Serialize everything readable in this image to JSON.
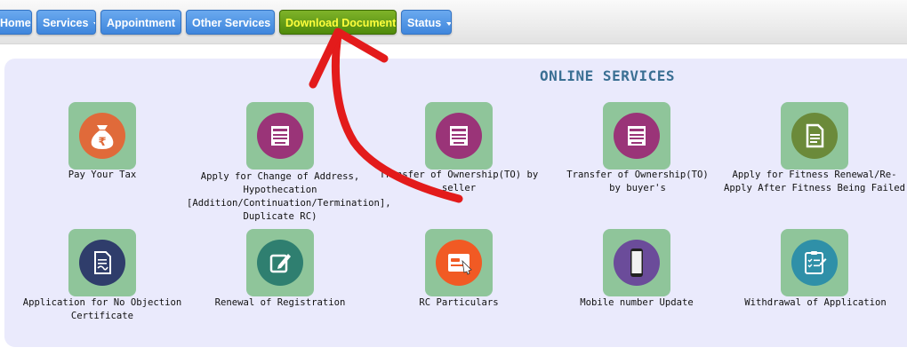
{
  "nav": {
    "home": "Home",
    "services": "Services",
    "appointment": "Appointment",
    "other_services": "Other Services",
    "download_document": "Download Document",
    "status": "Status"
  },
  "panel": {
    "title": "ONLINE SERVICES"
  },
  "services": [
    {
      "label": "Pay Your Tax",
      "icon": "money-bag-rupee-icon",
      "color": "#e06a3a"
    },
    {
      "label": "Apply for Change of Address, Hypothecation [Addition/Continuation/Termination], Duplicate RC)",
      "icon": "form-document-icon",
      "color": "#9a3478"
    },
    {
      "label": "Transfer of Ownership(TO) by seller",
      "icon": "form-document-icon",
      "color": "#9a3478"
    },
    {
      "label": "Transfer of Ownership(TO) by buyer's",
      "icon": "form-document-icon",
      "color": "#9a3478"
    },
    {
      "label": "Apply for Fitness Renewal/Re-Apply After Fitness Being Failed",
      "icon": "document-icon",
      "color": "#6b8a3a"
    },
    {
      "label": "Application for No Objection Certificate",
      "icon": "certificate-icon",
      "color": "#2f3d6b"
    },
    {
      "label": "Renewal of Registration",
      "icon": "edit-icon",
      "color": "#2f7f70"
    },
    {
      "label": "RC Particulars",
      "icon": "rc-card-icon",
      "color": "#f15a24"
    },
    {
      "label": "Mobile number Update",
      "icon": "mobile-phone-icon",
      "color": "#6b4c9a"
    },
    {
      "label": "Withdrawal of Application",
      "icon": "clipboard-checklist-icon",
      "color": "#2f90a8"
    }
  ],
  "annotation": {
    "color": "#e31b1b"
  }
}
